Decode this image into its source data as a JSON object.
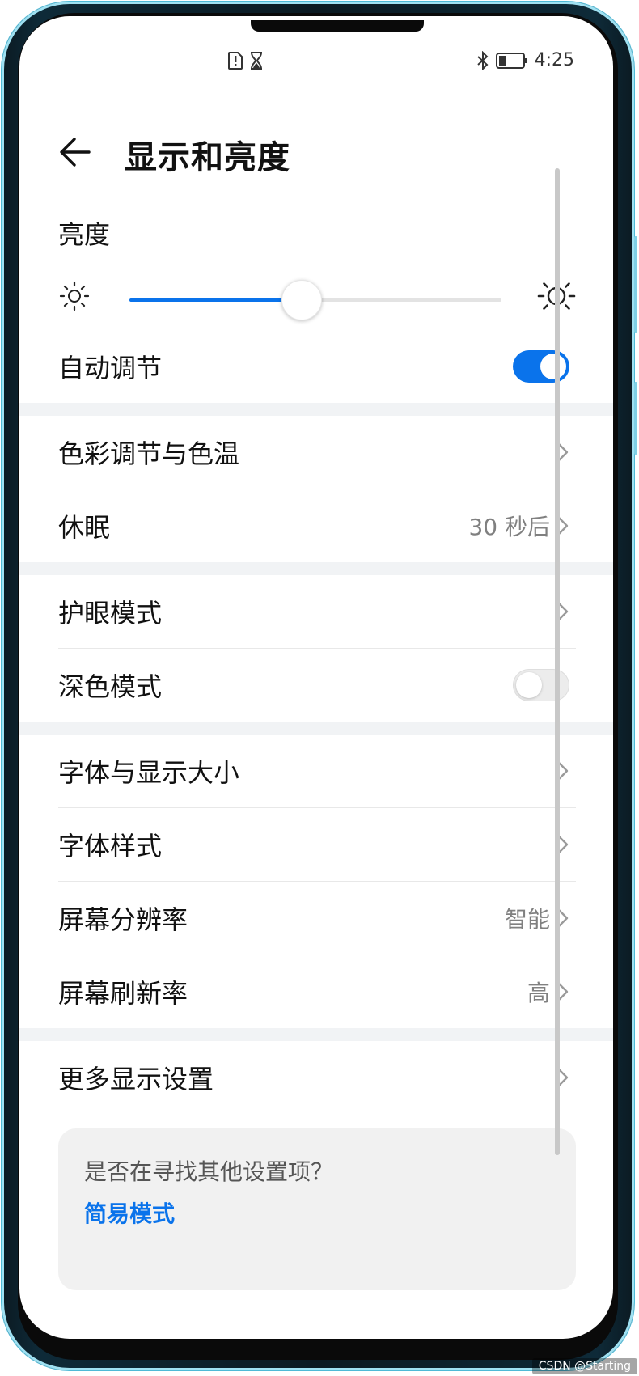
{
  "status_bar": {
    "time": "4:25",
    "icons": [
      "sim-alert-icon",
      "hourglass-icon",
      "bluetooth-icon",
      "battery-icon"
    ]
  },
  "header": {
    "title": "显示和亮度"
  },
  "brightness": {
    "label": "亮度",
    "level": 0.46
  },
  "auto_adjust": {
    "label": "自动调节",
    "on": true
  },
  "items": {
    "color_temp": {
      "label": "色彩调节与色温"
    },
    "sleep": {
      "label": "休眠",
      "value": "30 秒后"
    },
    "eye_comfort": {
      "label": "护眼模式"
    },
    "dark_mode": {
      "label": "深色模式",
      "on": false
    },
    "font_size": {
      "label": "字体与显示大小"
    },
    "font_style": {
      "label": "字体样式"
    },
    "resolution": {
      "label": "屏幕分辨率",
      "value": "智能"
    },
    "refresh_rate": {
      "label": "屏幕刷新率",
      "value": "高"
    },
    "more": {
      "label": "更多显示设置"
    }
  },
  "tip_card": {
    "question": "是否在寻找其他设置项？",
    "link": "简易模式"
  },
  "watermark": "CSDN @Starting",
  "colors": {
    "accent": "#0a73eb",
    "frame_edge": "#9fe1f2"
  }
}
